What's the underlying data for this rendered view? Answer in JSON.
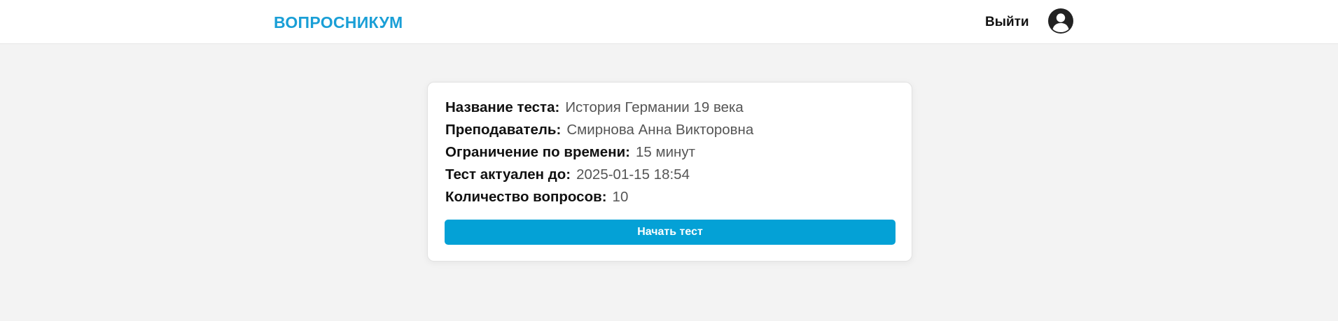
{
  "header": {
    "logo": "ВОПРОСНИКУМ",
    "logout_label": "Выйти",
    "avatar_icon": "user-circle-icon"
  },
  "test_info": {
    "name_label": "Название теста:",
    "name_value": "История Германии 19 века",
    "teacher_label": "Преподаватель:",
    "teacher_value": "Смирнова Анна Викторовна",
    "time_limit_label": "Ограничение по времени:",
    "time_limit_value": "15 минут",
    "valid_until_label": "Тест актуален до:",
    "valid_until_value": "2025-01-15 18:54",
    "question_count_label": "Количество вопросов:",
    "question_count_value": "10",
    "start_button_label": "Начать тест"
  },
  "colors": {
    "brand": "#1a9fd6",
    "button": "#04a1d6",
    "background": "#f3f3f3"
  }
}
